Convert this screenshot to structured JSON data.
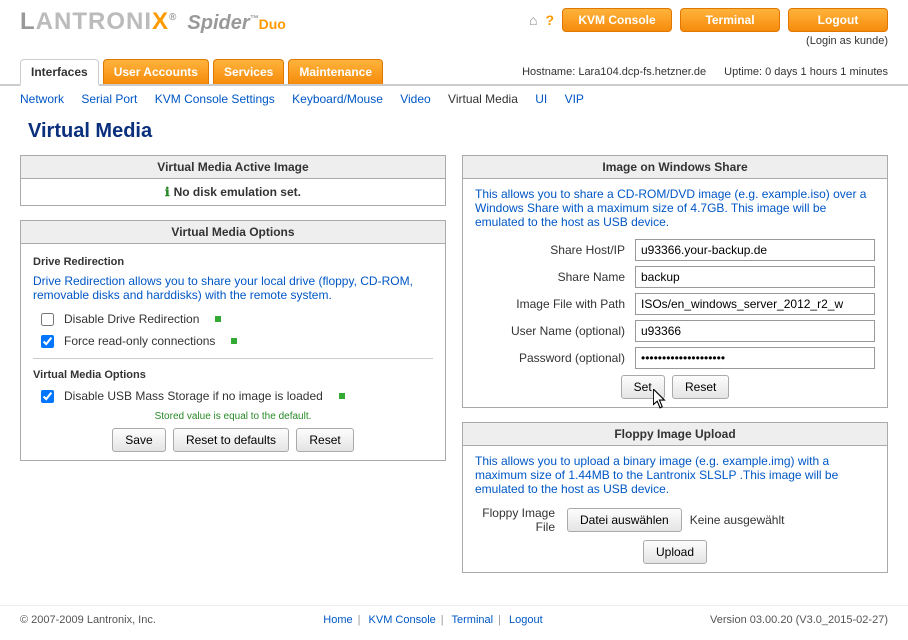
{
  "header": {
    "logo_main": "LANTRONIX",
    "logo_sub": "Spider",
    "logo_duo": "Duo",
    "btn_kvm": "KVM Console",
    "btn_terminal": "Terminal",
    "btn_logout": "Logout",
    "login_as": "(Login as kunde)"
  },
  "tabs": {
    "interfaces": "Interfaces",
    "user_accounts": "User Accounts",
    "services": "Services",
    "maintenance": "Maintenance"
  },
  "hostinfo": {
    "hostname_label": "Hostname: Lara104.dcp-fs.hetzner.de",
    "uptime_label": "Uptime: 0 days 1 hours 1 minutes"
  },
  "subnav": {
    "network": "Network",
    "serial": "Serial Port",
    "kvm_settings": "KVM Console Settings",
    "keyboard": "Keyboard/Mouse",
    "video": "Video",
    "virtual_media": "Virtual Media",
    "ui": "UI",
    "vip": "VIP"
  },
  "page_title": "Virtual Media",
  "active_image": {
    "title": "Virtual Media Active Image",
    "status": "No disk emulation set."
  },
  "options": {
    "title": "Virtual Media Options",
    "drive_redirection_label": "Drive Redirection",
    "drive_redirection_desc": "Drive Redirection allows you to share your local drive (floppy, CD-ROM, removable disks and harddisks) with the remote system.",
    "disable_drive_redir": "Disable Drive Redirection",
    "force_readonly": "Force read-only connections",
    "vm_options_label": "Virtual Media Options",
    "disable_usb": "Disable USB Mass Storage if no image is loaded",
    "stored_default": "Stored value is equal to the default.",
    "save": "Save",
    "reset_defaults": "Reset to defaults",
    "reset": "Reset"
  },
  "winshare": {
    "title": "Image on Windows Share",
    "desc": "This allows you to share a CD-ROM/DVD image (e.g. example.iso) over a Windows Share with a maximum size of 4.7GB. This image will be emulated to the host as USB device.",
    "share_host_label": "Share Host/IP",
    "share_host_value": "u93366.your-backup.de",
    "share_name_label": "Share Name",
    "share_name_value": "backup",
    "image_path_label": "Image File with Path",
    "image_path_value": "ISOs/en_windows_server_2012_r2_w",
    "username_label": "User Name (optional)",
    "username_value": "u93366",
    "password_label": "Password (optional)",
    "password_value": "••••••••••••••••••••",
    "set": "Set",
    "reset": "Reset"
  },
  "floppy": {
    "title": "Floppy Image Upload",
    "desc": "This allows you to upload a binary image (e.g. example.img) with a maximum size of 1.44MB to the Lantronix SLSLP .This image will be emulated to the host as USB device.",
    "file_label": "Floppy Image File",
    "choose": "Datei auswählen",
    "nofile": "Keine ausgewählt",
    "upload": "Upload"
  },
  "footer": {
    "copyright": "© 2007-2009 Lantronix, Inc.",
    "home": "Home",
    "kvm": "KVM Console",
    "terminal": "Terminal",
    "logout": "Logout",
    "version": "Version 03.00.20 (V3.0_2015-02-27)"
  }
}
